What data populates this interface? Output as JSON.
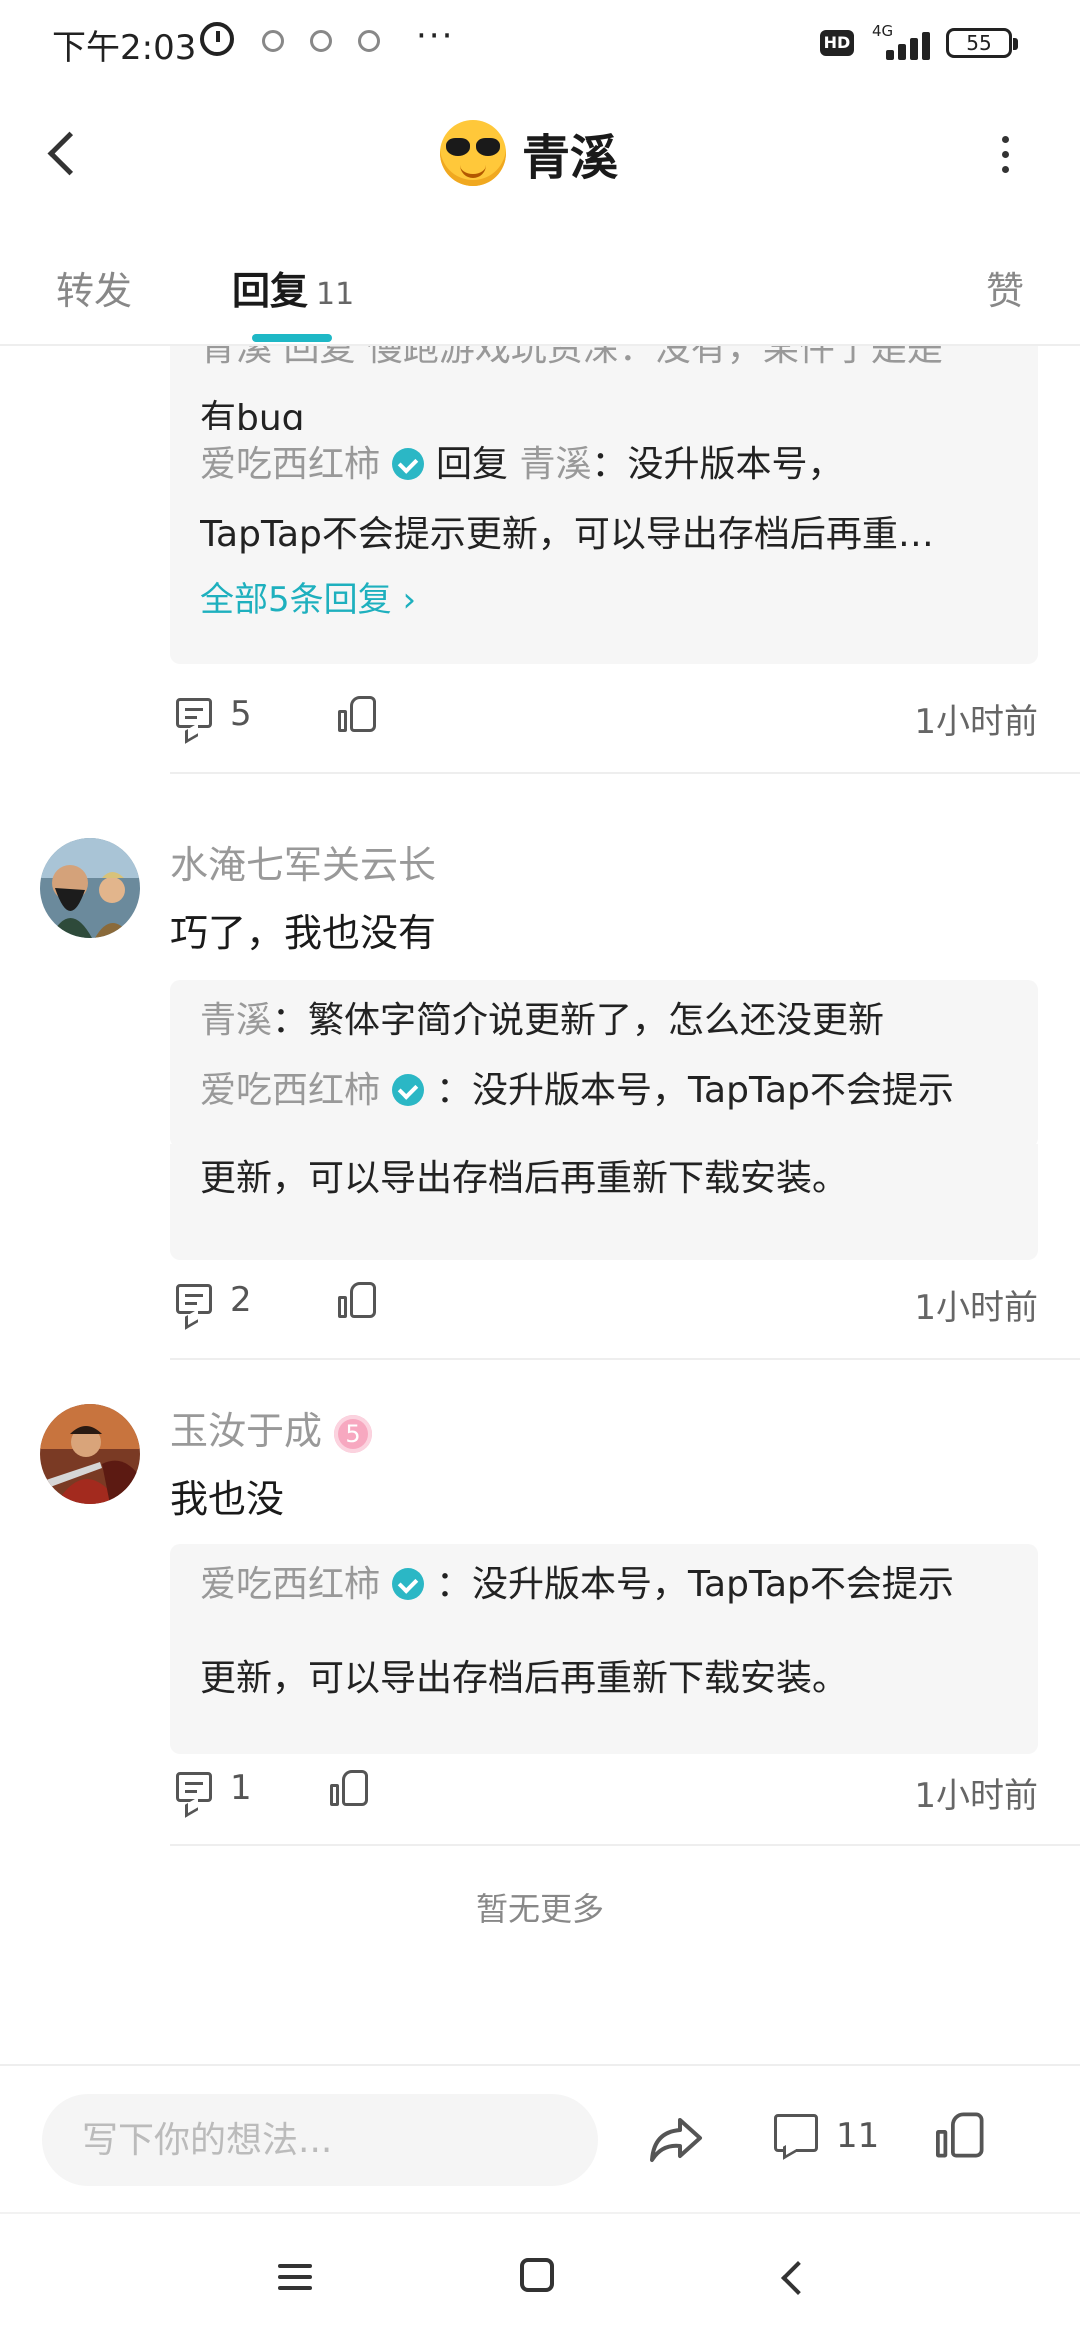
{
  "status_bar": {
    "time": "下午2:03",
    "network": "4G",
    "hd_badge": "HD",
    "battery": "55",
    "more": "···"
  },
  "header": {
    "title": "青溪",
    "back_icon": "chevron-left-icon",
    "more_icon": "more-vertical-icon"
  },
  "tabs": [
    {
      "label": "转发",
      "active": false
    },
    {
      "label": "回复",
      "count": "11",
      "active": true
    },
    {
      "label": "赞",
      "active": false
    }
  ],
  "thread_top": {
    "partial_line_1": "青溪 回复 慢跑游戏玩资深：没有，某件了是是",
    "partial_line_2": "有bug",
    "reply_author": "爱吃西红柿",
    "reply_word": "回复",
    "reply_target": "青溪",
    "reply_text_1": "：没升版本号，",
    "reply_text_2": "TapTap不会提示更新，可以导出存档后再重…",
    "all_replies": "全部5条回复",
    "comment_count": "5",
    "time": "1小时前"
  },
  "comments": [
    {
      "username": "水淹七军关云长",
      "text": "巧了，我也没有",
      "quote_lines": [
        {
          "name": "青溪",
          "text": "：繁体字简介说更新了，怎么还没更新"
        },
        {
          "name": "爱吃西红柿",
          "verified": true,
          "text": "：没升版本号，TapTap不会提示"
        },
        {
          "text": "更新，可以导出存档后再重新下载安装。"
        }
      ],
      "comment_count": "2",
      "time": "1小时前"
    },
    {
      "username": "玉汝于成",
      "level": "5",
      "text": "我也没",
      "quote_lines": [
        {
          "name": "爱吃西红柿",
          "verified": true,
          "text": "：没升版本号，TapTap不会提示"
        },
        {
          "text": "更新，可以导出存档后再重新下载安装。"
        }
      ],
      "comment_count": "1",
      "time": "1小时前"
    }
  ],
  "no_more": "暂无更多",
  "bottom_bar": {
    "composer_placeholder": "写下你的想法...",
    "comment_count": "11"
  },
  "colors": {
    "accent": "#1eb8c6",
    "verified": "#2bb7c5",
    "quote_bg": "#f6f6f6",
    "muted_text": "#999999"
  }
}
